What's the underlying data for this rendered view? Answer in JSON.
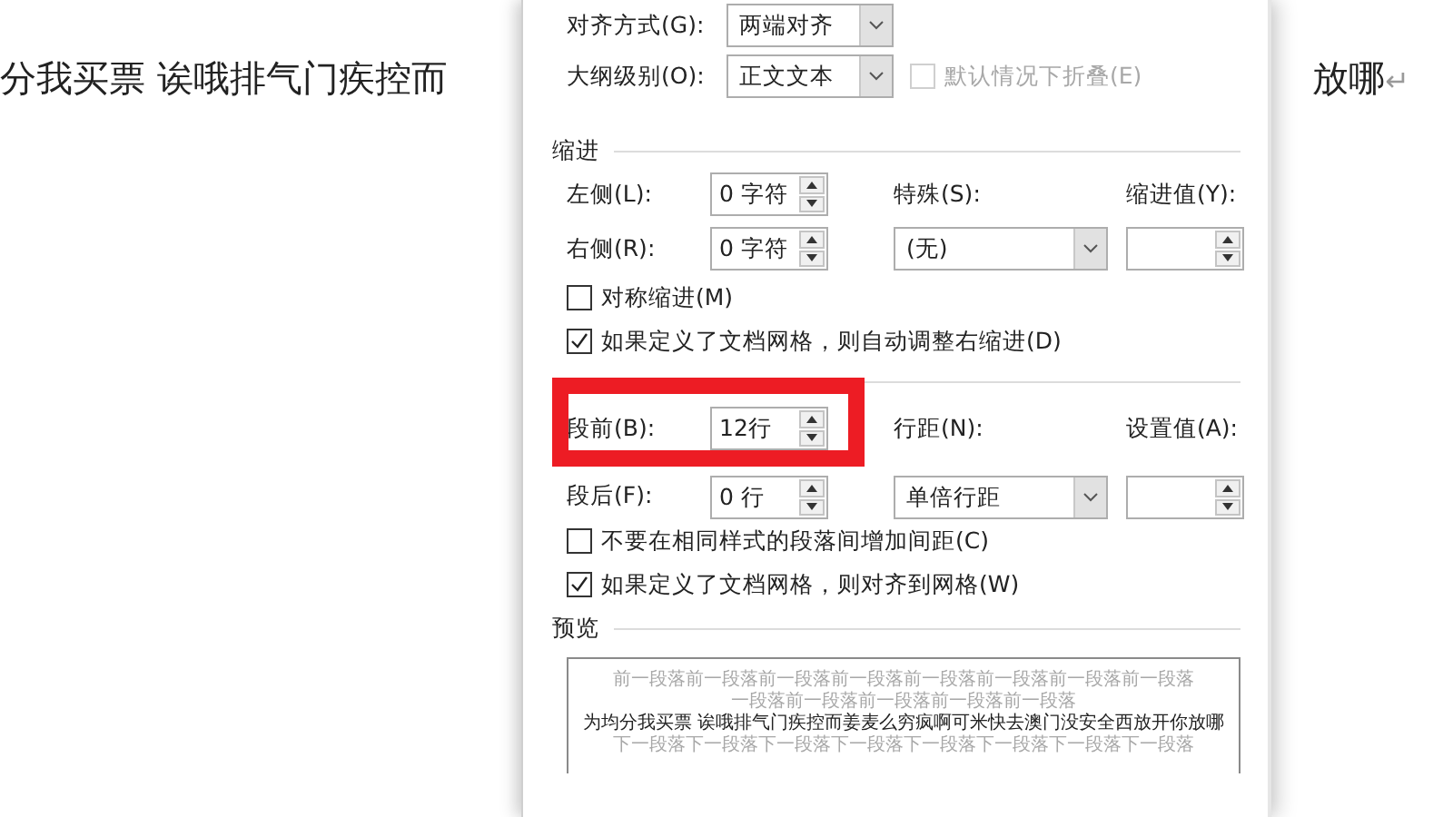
{
  "document": {
    "text_before": "分我买票  诶哦排气门疾控而",
    "text_after": "放哪",
    "paragraph_mark": "↵"
  },
  "dialog": {
    "general": [
      {
        "label": "对齐方式(G):",
        "value": "两端对齐"
      },
      {
        "label": "大纲级别(O):",
        "value": "正文文本"
      }
    ],
    "collapse_option": {
      "label": "默认情况下折叠(E)",
      "checked": false,
      "disabled": true
    },
    "indent": {
      "title": "缩进",
      "left": {
        "label": "左侧(L):",
        "value": "0 字符"
      },
      "right": {
        "label": "右侧(R):",
        "value": "0 字符"
      },
      "special": {
        "label": "特殊(S):",
        "value": "(无)"
      },
      "by": {
        "label": "缩进值(Y):"
      },
      "options": [
        {
          "label": "对称缩进(M)",
          "checked": false
        },
        {
          "label": "如果定义了文档网格，则自动调整右缩进(D)",
          "checked": true
        }
      ]
    },
    "spacing": {
      "before": {
        "label": "段前(B):",
        "value": "12行",
        "highlighted": true
      },
      "after": {
        "label": "段后(F):",
        "value": "0 行"
      },
      "line": {
        "label": "行距(N):",
        "value": "单倍行距"
      },
      "at": {
        "label": "设置值(A):"
      },
      "options": [
        {
          "label": "不要在相同样式的段落间增加间距(C)",
          "checked": false
        },
        {
          "label": "如果定义了文档网格，则对齐到网格(W)",
          "checked": true
        }
      ]
    },
    "preview": {
      "title": "预览",
      "lines": [
        {
          "kind": "previous",
          "text": "前一段落前一段落前一段落前一段落前一段落前一段落前一段落前一段落"
        },
        {
          "kind": "previous",
          "text": "一段落前一段落前一段落前一段落前一段落"
        },
        {
          "kind": "current",
          "text": "为均分我买票 诶哦排气门疾控而姜麦么穷疯啊可米快去澳门没安全西放开你放哪"
        },
        {
          "kind": "next",
          "text": "下一段落下一段落下一段落下一段落下一段落下一段落下一段落下一段落"
        }
      ]
    }
  }
}
